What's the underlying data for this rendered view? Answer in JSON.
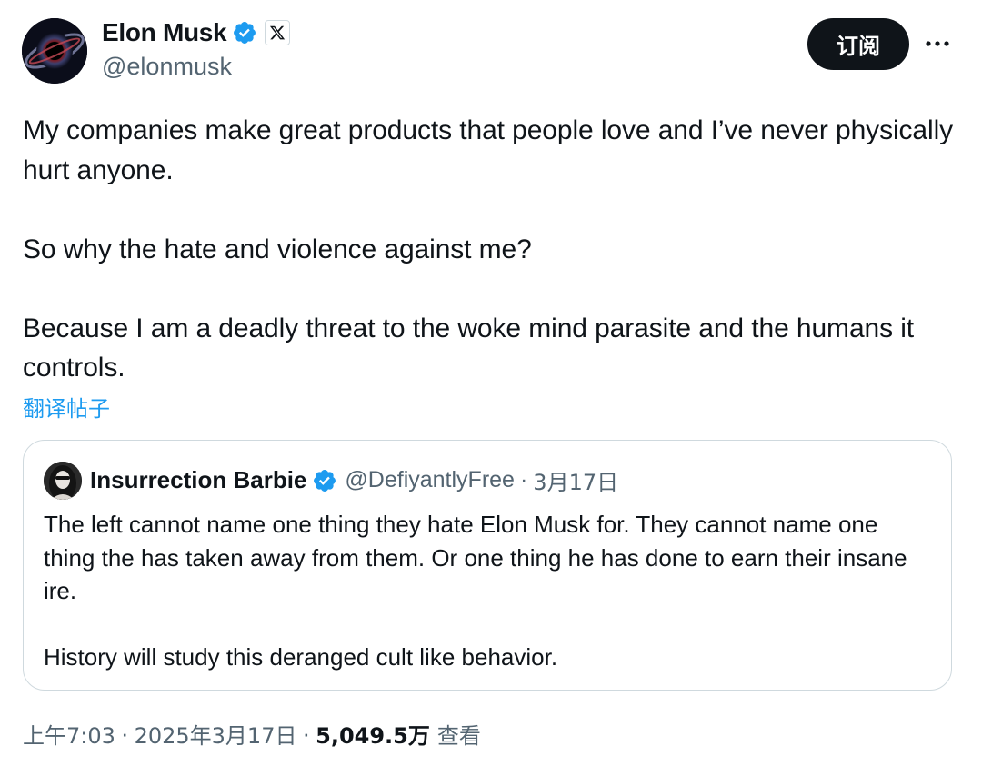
{
  "author": {
    "name": "Elon Musk",
    "handle": "@elonmusk",
    "verified": true,
    "affiliate_badge": "x-logo-icon"
  },
  "actions": {
    "subscribe_label": "订阅",
    "more_icon": "more-icon"
  },
  "post": {
    "paragraphs": [
      "My companies make great products that people love and I’ve never physically hurt anyone.",
      "So why the hate and violence against me?",
      "Because I am a deadly threat to the woke mind parasite and the humans it controls."
    ],
    "translate_label": "翻译帖子"
  },
  "quote": {
    "name": "Insurrection Barbie",
    "handle": "@DefiyantlyFree",
    "separator": "·",
    "date": "3月17日",
    "verified": true,
    "paragraphs": [
      "The left cannot name one thing they hate Elon Musk for. They cannot name one thing the has taken away from them. Or one thing he has done to earn their insane ire.",
      "History will study this deranged cult like behavior."
    ]
  },
  "meta": {
    "time": "上午7:03",
    "separator": "·",
    "date": "2025年3月17日",
    "views": "5,049.5万",
    "views_label": "查看"
  },
  "colors": {
    "text": "#0f1419",
    "secondary": "#536471",
    "link": "#1d9bf0",
    "verified": "#1d9bf0",
    "border": "#cfd9de",
    "button_bg": "#0f1419"
  }
}
